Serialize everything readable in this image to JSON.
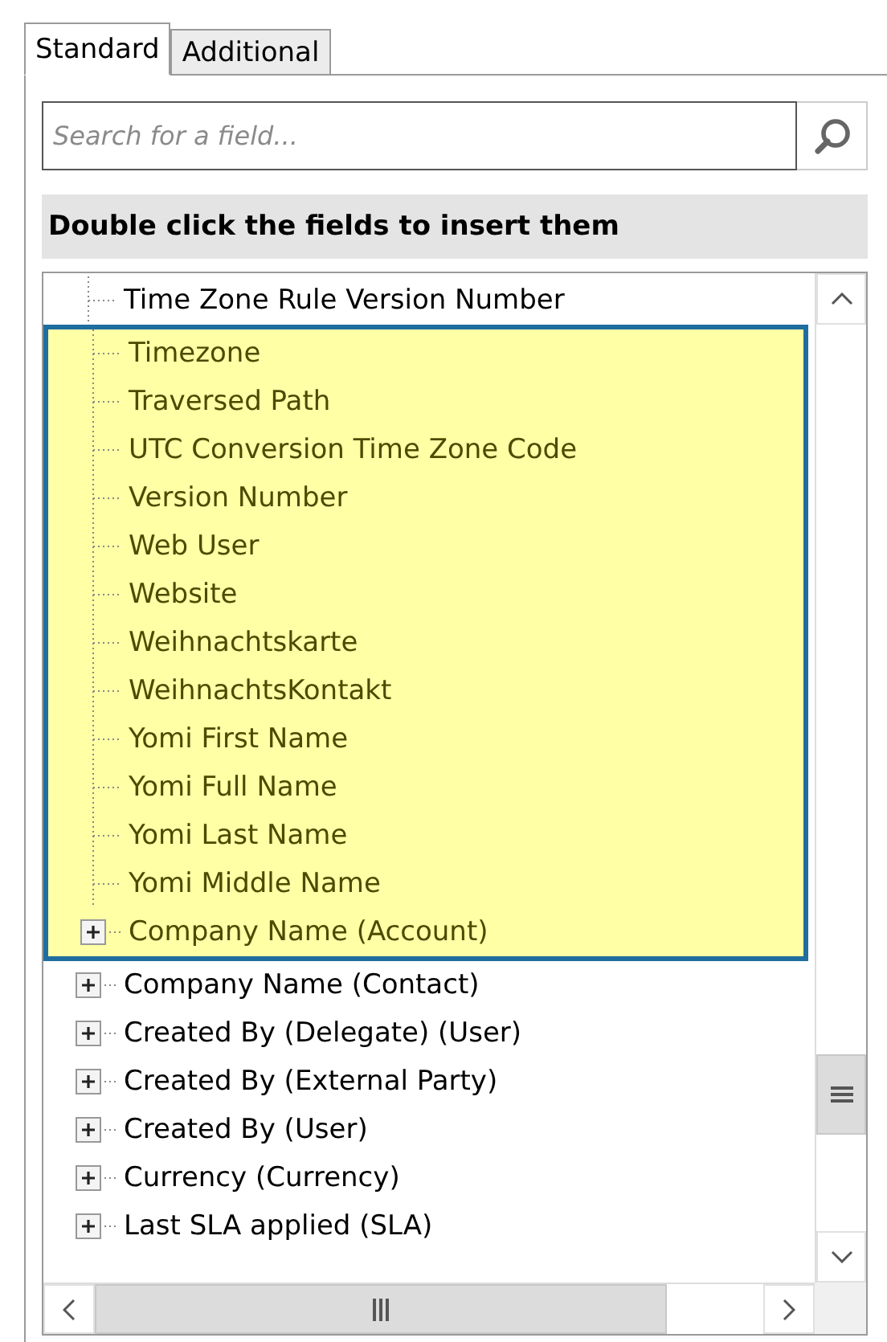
{
  "tabs": [
    {
      "label": "Standard",
      "selected": true
    },
    {
      "label": "Additional",
      "selected": false
    }
  ],
  "search": {
    "placeholder": "Search for a field..."
  },
  "header": "Double click the fields to insert them",
  "tree": {
    "items": [
      {
        "label": "Time Zone Rule Version Number",
        "kind": "leaf",
        "highlighted": false
      },
      {
        "label": "Timezone",
        "kind": "leaf",
        "highlighted": true
      },
      {
        "label": "Traversed Path",
        "kind": "leaf",
        "highlighted": true
      },
      {
        "label": "UTC Conversion Time Zone Code",
        "kind": "leaf",
        "highlighted": true
      },
      {
        "label": "Version Number",
        "kind": "leaf",
        "highlighted": true
      },
      {
        "label": "Web User",
        "kind": "leaf",
        "highlighted": true
      },
      {
        "label": "Website",
        "kind": "leaf",
        "highlighted": true
      },
      {
        "label": "Weihnachtskarte",
        "kind": "leaf",
        "highlighted": true
      },
      {
        "label": "WeihnachtsKontakt",
        "kind": "leaf",
        "highlighted": true
      },
      {
        "label": "Yomi First Name",
        "kind": "leaf",
        "highlighted": true
      },
      {
        "label": "Yomi Full Name",
        "kind": "leaf",
        "highlighted": true
      },
      {
        "label": "Yomi Last Name",
        "kind": "leaf",
        "highlighted": true
      },
      {
        "label": "Yomi Middle Name",
        "kind": "leaf",
        "highlighted": true
      },
      {
        "label": "Company Name (Account)",
        "kind": "expandable",
        "highlighted": true
      },
      {
        "label": "Company Name (Contact)",
        "kind": "expandable",
        "highlighted": false
      },
      {
        "label": "Created By (Delegate) (User)",
        "kind": "expandable",
        "highlighted": false
      },
      {
        "label": "Created By (External Party)",
        "kind": "expandable",
        "highlighted": false
      },
      {
        "label": "Created By (User)",
        "kind": "expandable",
        "highlighted": false
      },
      {
        "label": "Currency (Currency)",
        "kind": "expandable",
        "highlighted": false
      },
      {
        "label": "Last SLA applied (SLA)",
        "kind": "expandable",
        "highlighted": false
      }
    ]
  }
}
